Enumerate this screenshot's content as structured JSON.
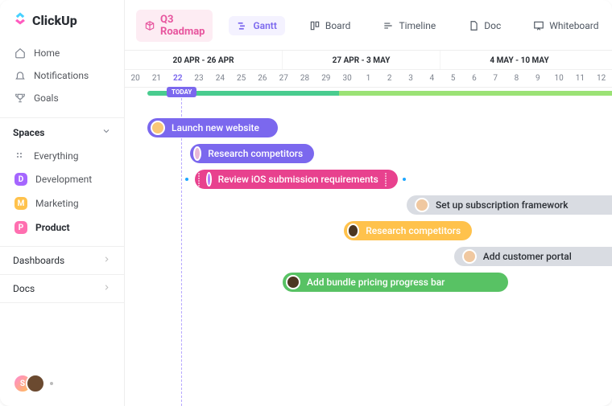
{
  "brand": {
    "name": "ClickUp"
  },
  "nav": {
    "home": "Home",
    "notifications": "Notifications",
    "goals": "Goals"
  },
  "spaces": {
    "heading": "Spaces",
    "everything": "Everything",
    "items": [
      {
        "label": "Development",
        "letter": "D",
        "color": "#a566ff"
      },
      {
        "label": "Marketing",
        "letter": "M",
        "color": "#ffc24c"
      },
      {
        "label": "Product",
        "letter": "P",
        "color": "#ff6fb0"
      }
    ]
  },
  "collapsibles": {
    "dashboards": "Dashboards",
    "docs": "Docs"
  },
  "header": {
    "title": "Q3 Roadmap",
    "views": {
      "gantt": "Gantt",
      "board": "Board",
      "timeline": "Timeline",
      "doc": "Doc",
      "whiteboard": "Whiteboard"
    }
  },
  "timeline": {
    "day_width": 28,
    "left_offset": 0,
    "periods": [
      {
        "label": "20 APR - 26 APR",
        "span": 7
      },
      {
        "label": "27 APR - 3 MAY",
        "span": 7
      },
      {
        "label": "4 MAY - 10 MAY",
        "span": 7
      }
    ],
    "days": [
      "20",
      "21",
      "22",
      "23",
      "24",
      "25",
      "26",
      "27",
      "28",
      "29",
      "30",
      "1",
      "2",
      "3",
      "4",
      "5",
      "6",
      "7",
      "8",
      "9",
      "10",
      "11",
      "12"
    ],
    "today_index": 2,
    "today_label": "TODAY",
    "progress": {
      "start_index": 1,
      "end_index": 22,
      "break_index": 9.5,
      "color_a": "#49cc8f",
      "color_b": "#9be275"
    },
    "tasks": [
      {
        "label": "Launch new website",
        "start": 1,
        "span": 5.8,
        "color": "#7b68ee",
        "avatar_bg": "#f9c777"
      },
      {
        "label": "Research competitors",
        "start": 2.9,
        "span": 5.5,
        "color": "#7b68ee",
        "avatar_bg": "#e7b8d6"
      },
      {
        "label": "Review iOS submission requirements",
        "start": 3.1,
        "span": 9,
        "color": "#e8418e",
        "avatar_bg": "#b07dff",
        "grip": true,
        "left_link": "#1ea7ff",
        "right_link": "#1ea7ff"
      },
      {
        "label": "Set up subscription framework",
        "start": 12.5,
        "span": 10.5,
        "color": "#d9dce2",
        "text_dark": true,
        "avatar_bg": "#f0c8a0"
      },
      {
        "label": "Research competitors",
        "start": 9.7,
        "span": 5.7,
        "color": "#ffc24c",
        "avatar_bg": "#4b3621"
      },
      {
        "label": "Add customer portal",
        "start": 14.6,
        "span": 8.4,
        "color": "#d9dce2",
        "text_dark": true,
        "avatar_bg": "#f0c8a0"
      },
      {
        "label": "Add bundle pricing progress bar",
        "start": 7,
        "span": 10,
        "color": "#58c264",
        "avatar_bg": "#4b3621"
      }
    ]
  }
}
